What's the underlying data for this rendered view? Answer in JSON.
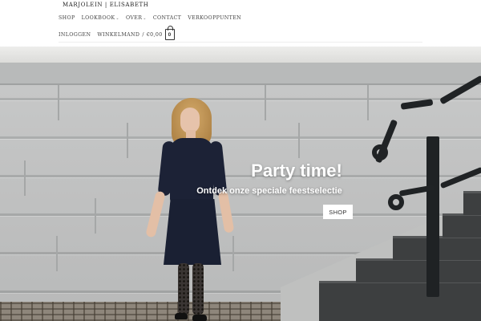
{
  "brand": {
    "logo_text": "MARJOLEIN | ELISABETH"
  },
  "nav": {
    "primary": [
      {
        "label": "SHOP",
        "has_dropdown": false
      },
      {
        "label": "LOOKBOOK",
        "has_dropdown": true
      },
      {
        "label": "OVER",
        "has_dropdown": true
      },
      {
        "label": "CONTACT",
        "has_dropdown": false
      },
      {
        "label": "VERKOOPPUNTEN",
        "has_dropdown": false
      }
    ],
    "login_label": "INLOGGEN",
    "cart": {
      "label": "WINKELMAND",
      "separator": "/",
      "amount": "€0,00",
      "count": "0"
    }
  },
  "hero": {
    "title": "Party time!",
    "subtitle": "Ontdek onze speciale feestselectie",
    "button_label": "SHOP"
  },
  "icons": {
    "dropdown": "chevron-down-icon",
    "cart": "shopping-bag-icon"
  },
  "colors": {
    "header_background": "#ffffff",
    "nav_text": "#444444",
    "hero_text": "#ffffff",
    "button_background": "#ffffff",
    "dress": "#1c2236"
  }
}
